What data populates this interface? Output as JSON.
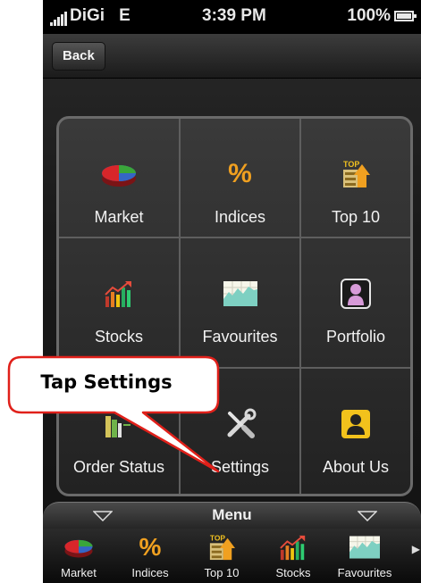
{
  "status_bar": {
    "carrier": "DiGi",
    "network": "E",
    "time": "3:39 PM",
    "battery": "100%"
  },
  "navbar": {
    "back_label": "Back"
  },
  "grid": {
    "items": [
      {
        "label": "Market",
        "icon": "pie-chart-icon"
      },
      {
        "label": "Indices",
        "icon": "percent-icon"
      },
      {
        "label": "Top 10",
        "icon": "top10-icon"
      },
      {
        "label": "Stocks",
        "icon": "stocks-bar-icon"
      },
      {
        "label": "Favourites",
        "icon": "favourites-chart-icon"
      },
      {
        "label": "Portfolio",
        "icon": "portfolio-person-icon"
      },
      {
        "label": "Order Status",
        "icon": "order-status-icon"
      },
      {
        "label": "Settings",
        "icon": "wrench-screwdriver-icon"
      },
      {
        "label": "About Us",
        "icon": "about-person-icon"
      }
    ]
  },
  "menu_bar": {
    "title": "Menu"
  },
  "tab_bar": {
    "items": [
      {
        "label": "Market",
        "icon": "pie-chart-icon"
      },
      {
        "label": "Indices",
        "icon": "percent-icon"
      },
      {
        "label": "Top 10",
        "icon": "top10-icon"
      },
      {
        "label": "Stocks",
        "icon": "stocks-bar-icon"
      },
      {
        "label": "Favourites",
        "icon": "favourites-chart-icon"
      }
    ]
  },
  "callout": {
    "text": "Tap Settings"
  },
  "colors": {
    "icon_orange": "#f0a020",
    "pie_red": "#d8262a",
    "pie_green": "#3aa63a",
    "pie_blue": "#3566c6",
    "portfolio_pink": "#d79ad8",
    "about_yellow": "#f2c21c"
  }
}
